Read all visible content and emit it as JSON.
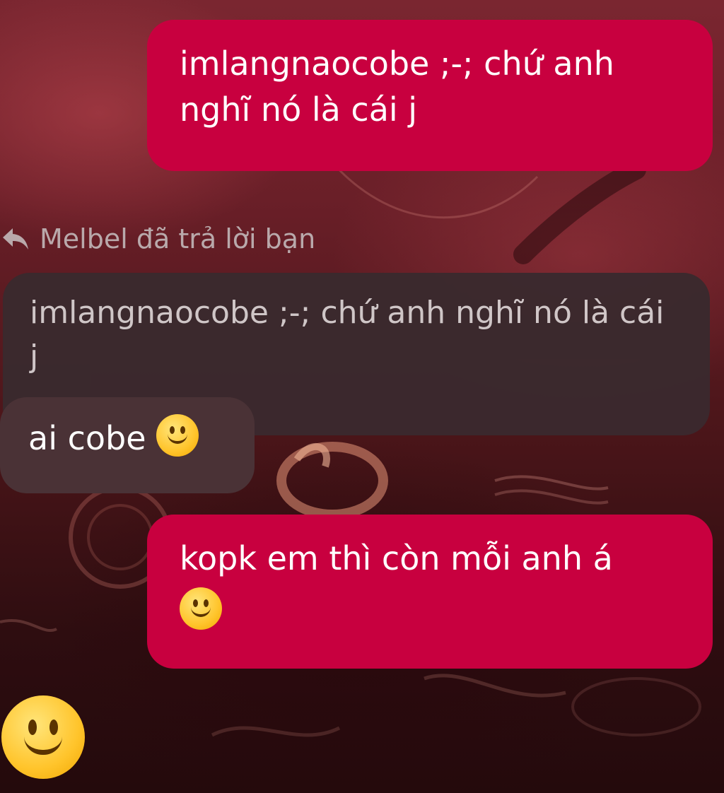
{
  "messages": {
    "msg1": {
      "text": "imlangnaocobe ;-; chứ anh nghĩ nó là cái j"
    },
    "reply_header": {
      "text": "Melbel đã trả lời bạn",
      "icon": "reply-arrow-icon"
    },
    "quoted": {
      "text": "imlangnaocobe ;-; chứ anh nghĩ nó là cái j"
    },
    "msg2": {
      "text": "ai cobe",
      "emoji": "slightly-smiling-face"
    },
    "msg3": {
      "text": "kopk em thì còn mỗi anh á",
      "emoji": "slightly-smiling-face"
    },
    "standalone_emoji": {
      "emoji": "slightly-smiling-face"
    }
  },
  "colors": {
    "own_bubble": "#c8003f",
    "other_bubble": "#4a3236",
    "quoted_bubble": "#3a2a2e",
    "background": "#5a1a21"
  }
}
